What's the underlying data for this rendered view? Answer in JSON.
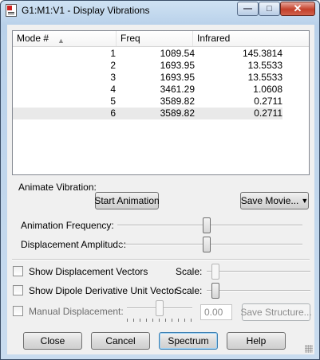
{
  "window": {
    "title": "G1:M1:V1 - Display Vibrations"
  },
  "table": {
    "columns": [
      "Mode #",
      "Freq",
      "Infrared"
    ],
    "rows": [
      {
        "mode": "1",
        "freq": "1089.54",
        "infrared": "145.3814"
      },
      {
        "mode": "2",
        "freq": "1693.95",
        "infrared": "13.5533"
      },
      {
        "mode": "3",
        "freq": "1693.95",
        "infrared": "13.5533"
      },
      {
        "mode": "4",
        "freq": "3461.29",
        "infrared": "1.0608"
      },
      {
        "mode": "5",
        "freq": "3589.82",
        "infrared": "0.2711"
      },
      {
        "mode": "6",
        "freq": "3589.82",
        "infrared": "0.2711"
      }
    ],
    "selected_row": 6
  },
  "animate": {
    "group_label": "Animate Vibration:",
    "start_label": "Start Animation",
    "save_movie_label": "Save Movie...",
    "frequency_label": "Animation Frequency:",
    "frequency_level": 0.48,
    "amplitude_label": "Displacement Amplitude:",
    "amplitude_level": 0.48
  },
  "options": {
    "show_vectors_label": "Show Displacement Vectors",
    "show_vectors_checked": false,
    "show_dipole_label": "Show Dipole Derivative Unit Vector",
    "show_dipole_checked": false,
    "scale_label": "Scale:",
    "vectors_scale_level": 0.05,
    "dipole_scale_level": 0.05,
    "manual_label": "Manual Displacement:",
    "manual_checked": false,
    "manual_level": 0.5,
    "manual_value": "0.00",
    "save_structure_label": "Save Structure..."
  },
  "footer": {
    "close_label": "Close",
    "cancel_label": "Cancel",
    "spectrum_label": "Spectrum",
    "help_label": "Help"
  }
}
